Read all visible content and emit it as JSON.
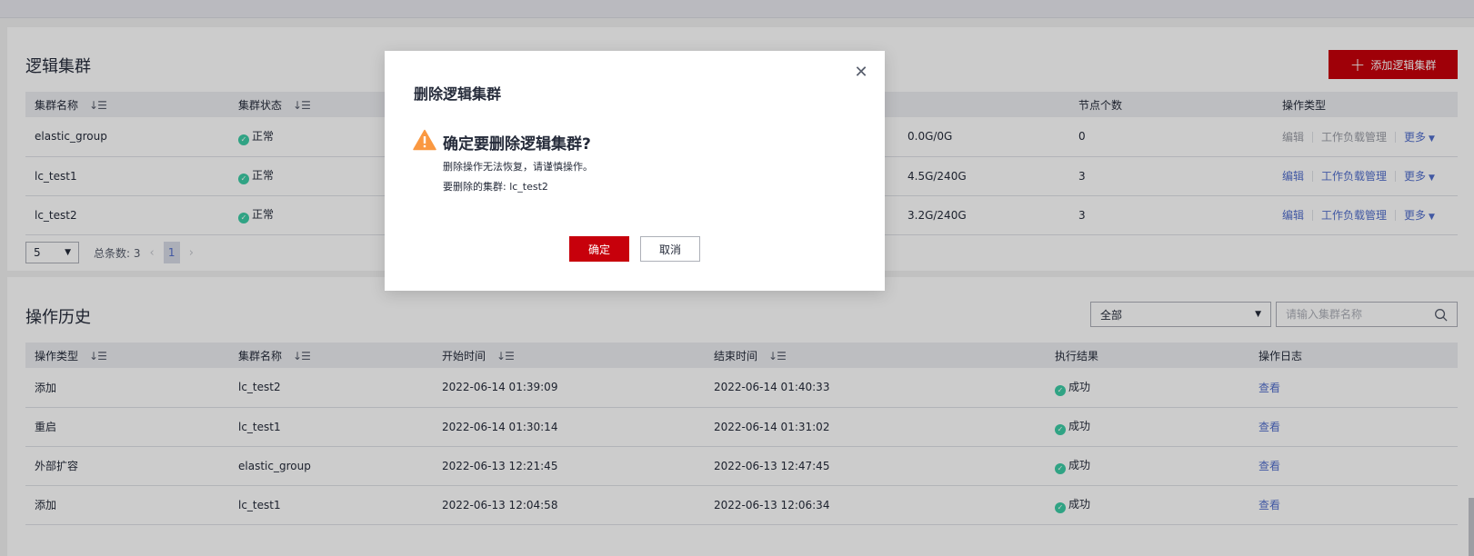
{
  "cluster_section": {
    "title": "逻辑集群",
    "add_button": "添加逻辑集群",
    "columns": [
      "集群名称",
      "集群状态",
      "",
      "节点个数",
      "操作类型"
    ],
    "rows": [
      {
        "name": "elastic_group",
        "status": "正常",
        "partial": "",
        "storage": "0.0G/0G",
        "nodes": "0",
        "edit_disabled": true
      },
      {
        "name": "lc_test1",
        "status": "正常",
        "partial": "",
        "storage": "4.5G/240G",
        "nodes": "3",
        "edit_disabled": false
      },
      {
        "name": "lc_test2",
        "status": "正常",
        "partial": "",
        "storage": "3.2G/240G",
        "nodes": "3",
        "edit_disabled": false
      }
    ],
    "actions": {
      "edit": "编辑",
      "workload": "工作负载管理",
      "more": "更多"
    },
    "pager": {
      "page_size": "5",
      "total": "总条数: 3",
      "current_page": "1"
    }
  },
  "history_section": {
    "title": "操作历史",
    "filter_value": "全部",
    "search_placeholder": "请输入集群名称",
    "columns": [
      "操作类型",
      "集群名称",
      "开始时间",
      "结束时间",
      "执行结果",
      "操作日志"
    ],
    "rows": [
      {
        "op": "添加",
        "cluster": "lc_test2",
        "start": "2022-06-14 01:39:09",
        "end": "2022-06-14 01:40:33",
        "result": "成功",
        "log": "查看"
      },
      {
        "op": "重启",
        "cluster": "lc_test1",
        "start": "2022-06-14 01:30:14",
        "end": "2022-06-14 01:31:02",
        "result": "成功",
        "log": "查看"
      },
      {
        "op": "外部扩容",
        "cluster": "elastic_group",
        "start": "2022-06-13 12:21:45",
        "end": "2022-06-13 12:47:45",
        "result": "成功",
        "log": "查看"
      },
      {
        "op": "添加",
        "cluster": "lc_test1",
        "start": "2022-06-13 12:04:58",
        "end": "2022-06-13 12:06:34",
        "result": "成功",
        "log": "查看"
      }
    ]
  },
  "dialog": {
    "title": "删除逻辑集群",
    "heading": "确定要删除逻辑集群?",
    "line1": "删除操作无法恢复，请谨慎操作。",
    "line2": "要删除的集群: lc_test2",
    "ok": "确定",
    "cancel": "取消"
  },
  "colors": {
    "brand": "#c7000b",
    "link": "#526ecc",
    "success": "#3dcca6",
    "warning": "#fa9841"
  }
}
